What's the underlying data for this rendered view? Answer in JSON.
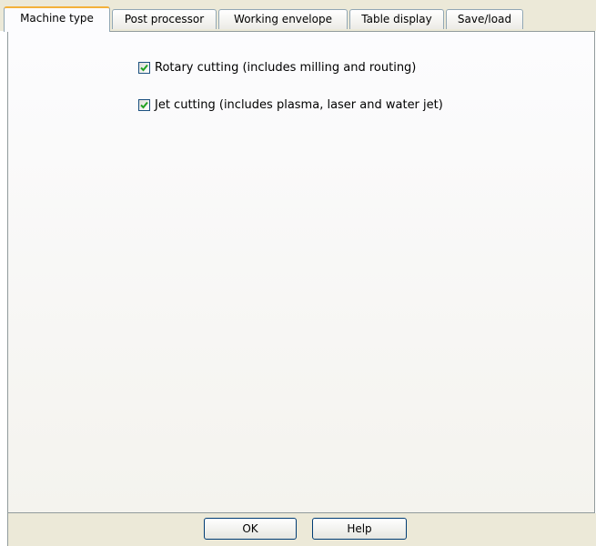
{
  "tabs": [
    {
      "label": "Machine type",
      "active": true
    },
    {
      "label": "Post processor",
      "active": false
    },
    {
      "label": "Working envelope",
      "active": false
    },
    {
      "label": "Table display",
      "active": false
    },
    {
      "label": "Save/load",
      "active": false
    }
  ],
  "options": [
    {
      "label": "Rotary cutting (includes milling and routing)",
      "checked": true
    },
    {
      "label": "Jet cutting (includes plasma, laser and water jet)",
      "checked": true
    }
  ],
  "buttons": {
    "ok": "OK",
    "help": "Help"
  },
  "colors": {
    "tab_highlight": "#f3b13b",
    "check_mark": "#21a121",
    "chrome": "#ece9d8",
    "border": "#919b9c"
  }
}
